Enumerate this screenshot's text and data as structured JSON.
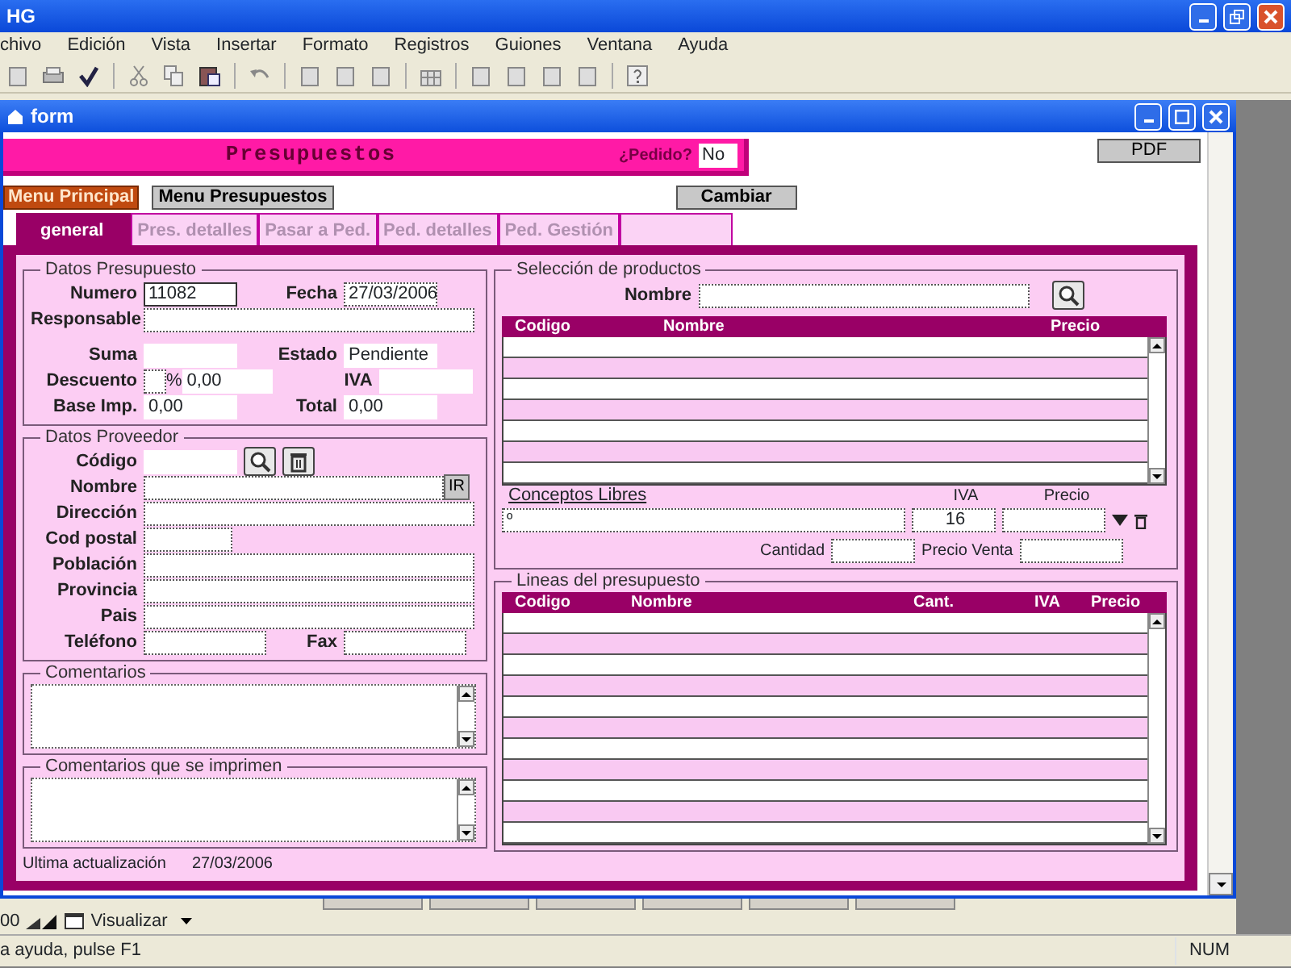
{
  "app": {
    "title": "HG"
  },
  "menu": [
    "chivo",
    "Edición",
    "Vista",
    "Insertar",
    "Formato",
    "Registros",
    "Guiones",
    "Ventana",
    "Ayuda"
  ],
  "form_window": {
    "title": "form"
  },
  "header": {
    "title": "Presupuestos",
    "pedido_label": "¿Pedido?",
    "pedido_value": "No"
  },
  "pdf_button": "PDF",
  "nav_buttons": [
    {
      "label": "Menu Principal",
      "kind": "primary"
    },
    {
      "label": "Menu Presupuestos",
      "kind": "secondary"
    }
  ],
  "cambiar_button": "Cambiar",
  "tabs": [
    {
      "label": "general",
      "selected": true
    },
    {
      "label": "Pres. detalles",
      "selected": false
    },
    {
      "label": "Pasar a Ped.",
      "selected": false
    },
    {
      "label": "Ped. detalles",
      "selected": false
    },
    {
      "label": "Ped. Gestión",
      "selected": false
    }
  ],
  "datos_presupuesto": {
    "title": "Datos Presupuesto",
    "rows": [
      [
        {
          "label": "Numero",
          "value": "11082",
          "kind": "solid"
        },
        {
          "label": "Fecha",
          "value": "27/03/2006",
          "kind": "dotted"
        }
      ],
      [
        {
          "label": "Responsable",
          "kind": "wide"
        }
      ]
    ],
    "summary_rows": [
      [
        {
          "label": "Suma",
          "kind": "flat"
        },
        {
          "label": "Estado",
          "value": "Pendiente",
          "kind": "flat"
        }
      ],
      [
        {
          "label": "Descuento",
          "kind": "discount",
          "unit": "%",
          "amount": "0,00"
        },
        {
          "label": "IVA",
          "kind": "flat"
        }
      ],
      [
        {
          "label": "Base Imp.",
          "value": "0,00",
          "kind": "flat"
        },
        {
          "label": "Total",
          "value": "0,00",
          "kind": "flat"
        }
      ]
    ]
  },
  "datos_proveedor": {
    "title": "Datos Proveedor",
    "rows": [
      [
        {
          "label": "Código",
          "kind": "lookup"
        }
      ],
      [
        {
          "label": "Nombre",
          "kind": "link",
          "button": "IR"
        }
      ],
      [
        {
          "label": "Dirección",
          "kind": "wide"
        }
      ],
      [
        {
          "label": "Cod postal",
          "kind": "short"
        }
      ],
      [
        {
          "label": "Población",
          "kind": "wide"
        }
      ],
      [
        {
          "label": "Provincia",
          "kind": "wide"
        }
      ],
      [
        {
          "label": "Pais",
          "kind": "wide"
        }
      ],
      [
        {
          "label": "Teléfono",
          "kind": "half"
        },
        {
          "label": "Fax",
          "kind": "half"
        }
      ]
    ]
  },
  "comentarios": {
    "title": "Comentarios"
  },
  "comentarios_impresos": {
    "title": "Comentarios que se imprimen"
  },
  "ultima_actualizacion": {
    "label": "Ultima actualización",
    "value": "27/03/2006"
  },
  "seleccion_productos": {
    "title": "Selección de productos",
    "search_label": "Nombre",
    "columns": [
      "Codigo",
      "Nombre",
      "Precio"
    ]
  },
  "conceptos_libres": {
    "label": "Conceptos Libres",
    "value": "º",
    "iva_label": "IVA",
    "iva_value": "16",
    "precio_label": "Precio",
    "cantidad_label": "Cantidad",
    "precio_venta_label": "Precio Venta"
  },
  "lineas_presupuesto": {
    "title": "Lineas del presupuesto",
    "columns": [
      "Codigo",
      "Nombre",
      "Cant.",
      "IVA",
      "Precio"
    ]
  },
  "record_bar": {
    "zoom": "00",
    "view_menu": "Visualizar"
  },
  "status_bar": {
    "message": "a ayuda, pulse F1",
    "indicator": "NUM"
  }
}
